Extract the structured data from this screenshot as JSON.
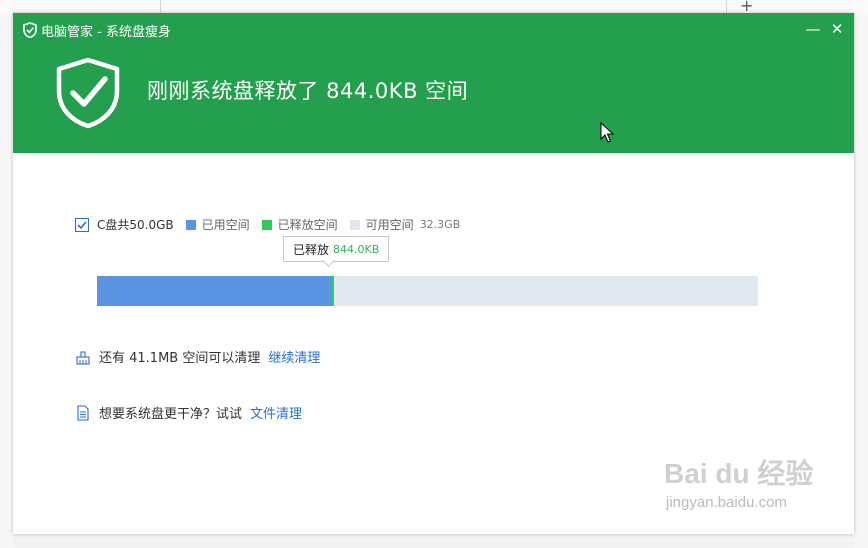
{
  "window": {
    "title": "电脑管家 - 系统盘瘦身",
    "minimize_glyph": "—",
    "close_glyph": "✕"
  },
  "header": {
    "headline": "刚刚系统盘释放了 844.0KB 空间",
    "icon": "shield-check-icon"
  },
  "disk": {
    "total_label": "C盘共50.0GB",
    "legend_used": "已用空间",
    "legend_freed": "已释放空间",
    "legend_free": "可用空间",
    "free_value": "32.3GB",
    "used_fraction": 0.354,
    "freed_fraction": 0.004
  },
  "tooltip": {
    "label": "已释放",
    "value": "844.0KB"
  },
  "rows": {
    "remaining_text": "还有 41.1MB 空间可以清理",
    "remaining_link": "继续清理",
    "suggest_text": "想要系统盘更干净？试试",
    "suggest_link": "文件清理"
  },
  "colors": {
    "header_green": "#249f4d",
    "used_blue": "#5b93e3",
    "freed_green": "#30c85a",
    "free_gray": "#e1e8f2",
    "link_blue": "#2a6fc9"
  },
  "watermark": {
    "logo": "Bai du 经验",
    "url": "jingyan.baidu.com"
  }
}
